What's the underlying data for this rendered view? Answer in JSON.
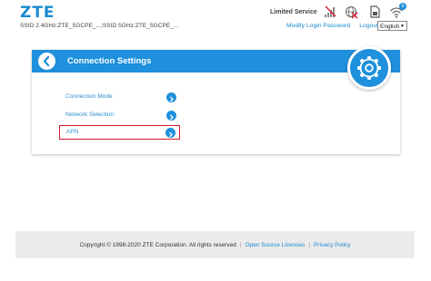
{
  "header": {
    "logo": "ZTE",
    "ssid_text": "SSID 2.4GHz:ZTE_5GCPE_...;SSID 5GHz:ZTE_5GCPE_...",
    "network_status": "Limited Service",
    "wifi_badge": "0",
    "links": {
      "modify_password": "Modify Login Password",
      "logout": "Logout"
    },
    "language": "English"
  },
  "icons": {
    "signal": "no-signal-icon",
    "network": "network-disconnected-icon",
    "sim": "sim-card-icon",
    "wifi": "wifi-icon",
    "back": "back-arrow-icon",
    "settings": "gear-icon",
    "go": "chevron-right-icon"
  },
  "panel": {
    "title": "Connection Settings",
    "items": [
      {
        "label": "Connection Mode"
      },
      {
        "label": "Network Selection"
      },
      {
        "label": "APN"
      }
    ]
  },
  "footer": {
    "copyright": "Copyright © 1998-2020 ZTE Corporation. All rights reserved",
    "open_source": "Open Source Licenses",
    "privacy": "Privacy Policy"
  },
  "colors": {
    "brand": "#1a8bd2",
    "header_bar": "#1e90dc",
    "selection": "#d9182c"
  }
}
